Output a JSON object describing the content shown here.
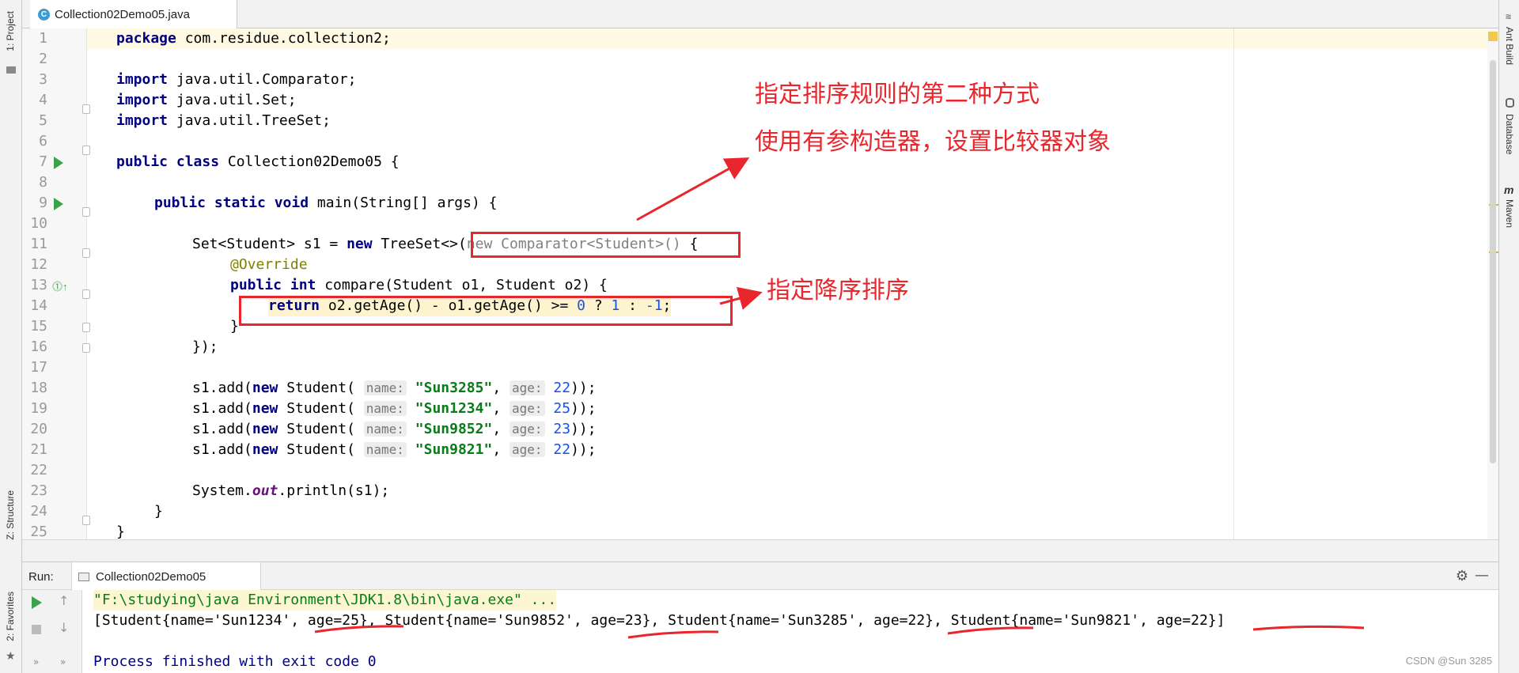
{
  "left_strip": {
    "project": "1: Project",
    "structure": "Z: Structure",
    "favorites": "2: Favorites"
  },
  "right_strip": {
    "ant": "Ant Build",
    "database": "Database",
    "maven": "Maven"
  },
  "tab": {
    "label": "Collection02Demo05.java",
    "icon": "C"
  },
  "line_numbers": [
    "1",
    "2",
    "3",
    "4",
    "5",
    "6",
    "7",
    "8",
    "9",
    "10",
    "11",
    "12",
    "13",
    "14",
    "15",
    "16",
    "17",
    "18",
    "19",
    "20",
    "21",
    "22",
    "23",
    "24",
    "25"
  ],
  "code": {
    "l1_kw": "package",
    "l1_rest": " com.residue.collection2;",
    "l3_kw": "import",
    "l3_rest": " java.util.Comparator;",
    "l4_kw": "import",
    "l4_rest": " java.util.Set;",
    "l5_kw": "import",
    "l5_rest": " java.util.TreeSet;",
    "l7_kw": "public class",
    "l7_rest": " Collection02Demo05 {",
    "l9_kw": "public static void",
    "l9_rest": " main(String[] args) {",
    "l11_a": "Set<Student> s1 = ",
    "l11_kw": "new",
    "l11_b": " TreeSet<>(",
    "l11_gray": "new Comparator<Student>()",
    "l11_c": " {",
    "l12_ann": "@Override",
    "l13_kw": "public int",
    "l13_rest": " compare(Student o1, Student o2) {",
    "l14_kw": "return",
    "l14_a": " o2.getAge() - o1.getAge() >= ",
    "l14_n0": "0",
    "l14_b": " ? ",
    "l14_n1": "1",
    "l14_c": " : ",
    "l14_n2": "-1",
    "l14_d": ";",
    "l15": "}",
    "l16": "});",
    "add_prefix": "s1.add(",
    "add_new": "new",
    "add_cls": " Student( ",
    "hint_name": "name:",
    "hint_age": "age:",
    "students": [
      {
        "name": "\"Sun3285\"",
        "age": "22"
      },
      {
        "name": "\"Sun1234\"",
        "age": "25"
      },
      {
        "name": "\"Sun9852\"",
        "age": "23"
      },
      {
        "name": "\"Sun9821\"",
        "age": "22"
      }
    ],
    "comma": ", ",
    "add_suffix": "));",
    "l23_a": "System.",
    "l23_fld": "out",
    "l23_b": ".println(s1);",
    "l24": "}",
    "l25": "}"
  },
  "annotations": {
    "title": "指定排序规则的第二种方式",
    "sub": "使用有参构造器，设置比较器对象",
    "desc": "指定降序排序"
  },
  "run": {
    "label": "Run:",
    "tab": "Collection02Demo05",
    "cmd": "\"F:\\studying\\java Environment\\JDK1.8\\bin\\java.exe\" ...",
    "output": "[Student{name='Sun1234', age=25}, Student{name='Sun9852', age=23}, Student{name='Sun3285', age=22}, Student{name='Sun9821', age=22}]",
    "exit": "Process finished with exit code 0"
  },
  "watermark": "CSDN @Sun 3285",
  "colors": {
    "annotation_red": "#e8262c",
    "keyword": "#000080",
    "string": "#067d17",
    "number": "#1750eb"
  }
}
